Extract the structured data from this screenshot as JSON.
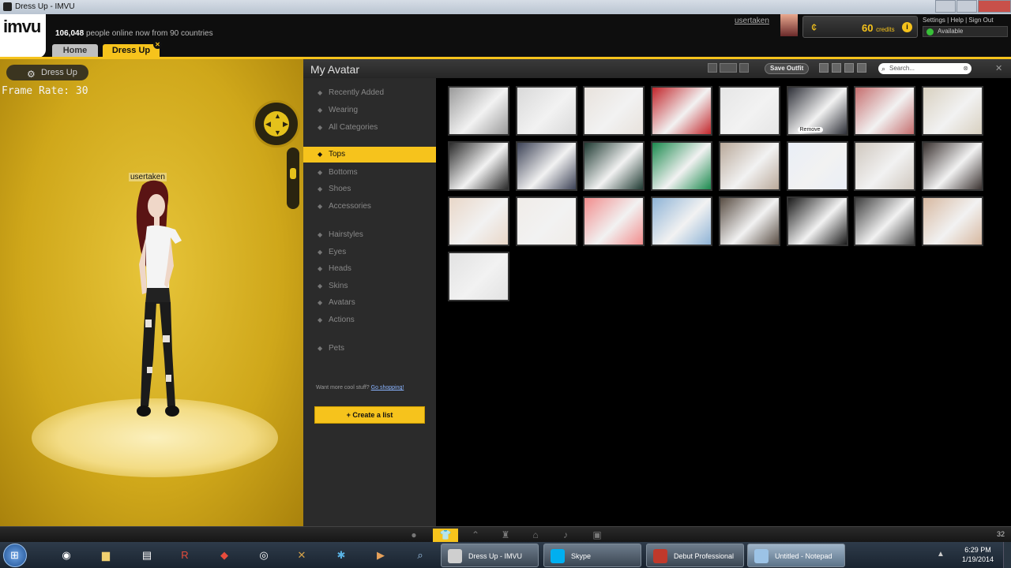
{
  "window": {
    "title": "Dress Up - IMVU"
  },
  "header": {
    "logo": "imvu",
    "online_count": "106,048",
    "online_rest": "people online now from 90 countries",
    "tabs": {
      "home": "Home",
      "dress_up": "Dress Up"
    },
    "username": "usertaken",
    "credits": {
      "amount": "60",
      "unit": "credits"
    },
    "links": [
      "Settings",
      "Help",
      "Sign Out"
    ],
    "status": "Available"
  },
  "scene": {
    "dress_up_button": "Dress Up",
    "frame_rate": "Frame Rate: 30",
    "avatar_name": "usertaken"
  },
  "panel": {
    "title": "My Avatar",
    "save_outfit": "Save Outfit",
    "search_placeholder": "Search...",
    "categories": [
      {
        "label": "Recently Added",
        "icon": "plus-icon"
      },
      {
        "label": "Wearing",
        "icon": "figure-icon"
      },
      {
        "label": "All Categories",
        "icon": "folder-icon"
      },
      {
        "label": "Tops",
        "icon": "shirt-icon",
        "selected": true
      },
      {
        "label": "Bottoms",
        "icon": "pants-icon"
      },
      {
        "label": "Shoes",
        "icon": "shoe-icon"
      },
      {
        "label": "Accessories",
        "icon": "heart-icon"
      },
      {
        "label": "Hairstyles",
        "icon": "hair-icon"
      },
      {
        "label": "Eyes",
        "icon": "eye-icon"
      },
      {
        "label": "Heads",
        "icon": "head-icon"
      },
      {
        "label": "Skins",
        "icon": "skin-icon"
      },
      {
        "label": "Avatars",
        "icon": "avatar-icon"
      },
      {
        "label": "Actions",
        "icon": "action-icon"
      },
      {
        "label": "Pets",
        "icon": "paw-icon"
      }
    ],
    "want_more_text": "Want more cool stuff?",
    "want_more_link": "Go shopping!",
    "create_list": "Create a list",
    "thumb_colors": [
      "#9a9a9a",
      "#d9d9d9",
      "#e8e2dc",
      "#c2262b",
      "#e6e6e6",
      "#2e3038",
      "#c56e6e",
      "#d8d0c0",
      "#2a2a2a",
      "#3c4256",
      "#1f3a32",
      "#1b8a4e",
      "#b9a99a",
      "#e9eef6",
      "#cfc7be",
      "#3a3230",
      "#e9d7c8",
      "#f0ece8",
      "#f28d8d",
      "#8eb3d6",
      "#5a4e44",
      "#1a1a1a",
      "#3d3d3d",
      "#d7b8a0",
      "#e2e2e2"
    ],
    "thumb_labels": {
      "5": "Remove"
    }
  },
  "bottombar": {
    "count": "32"
  },
  "taskbar": {
    "items": [
      {
        "label": "Dress Up - IMVU",
        "color": "#cfcfcf",
        "active": false
      },
      {
        "label": "Skype",
        "color": "#00aff0",
        "active": false
      },
      {
        "label": "Debut Professional",
        "color": "#c0392b",
        "active": false
      },
      {
        "label": "Untitled - Notepad",
        "color": "#9cc3e6",
        "active": true
      }
    ],
    "time": "6:29 PM",
    "date": "1/19/2014"
  }
}
